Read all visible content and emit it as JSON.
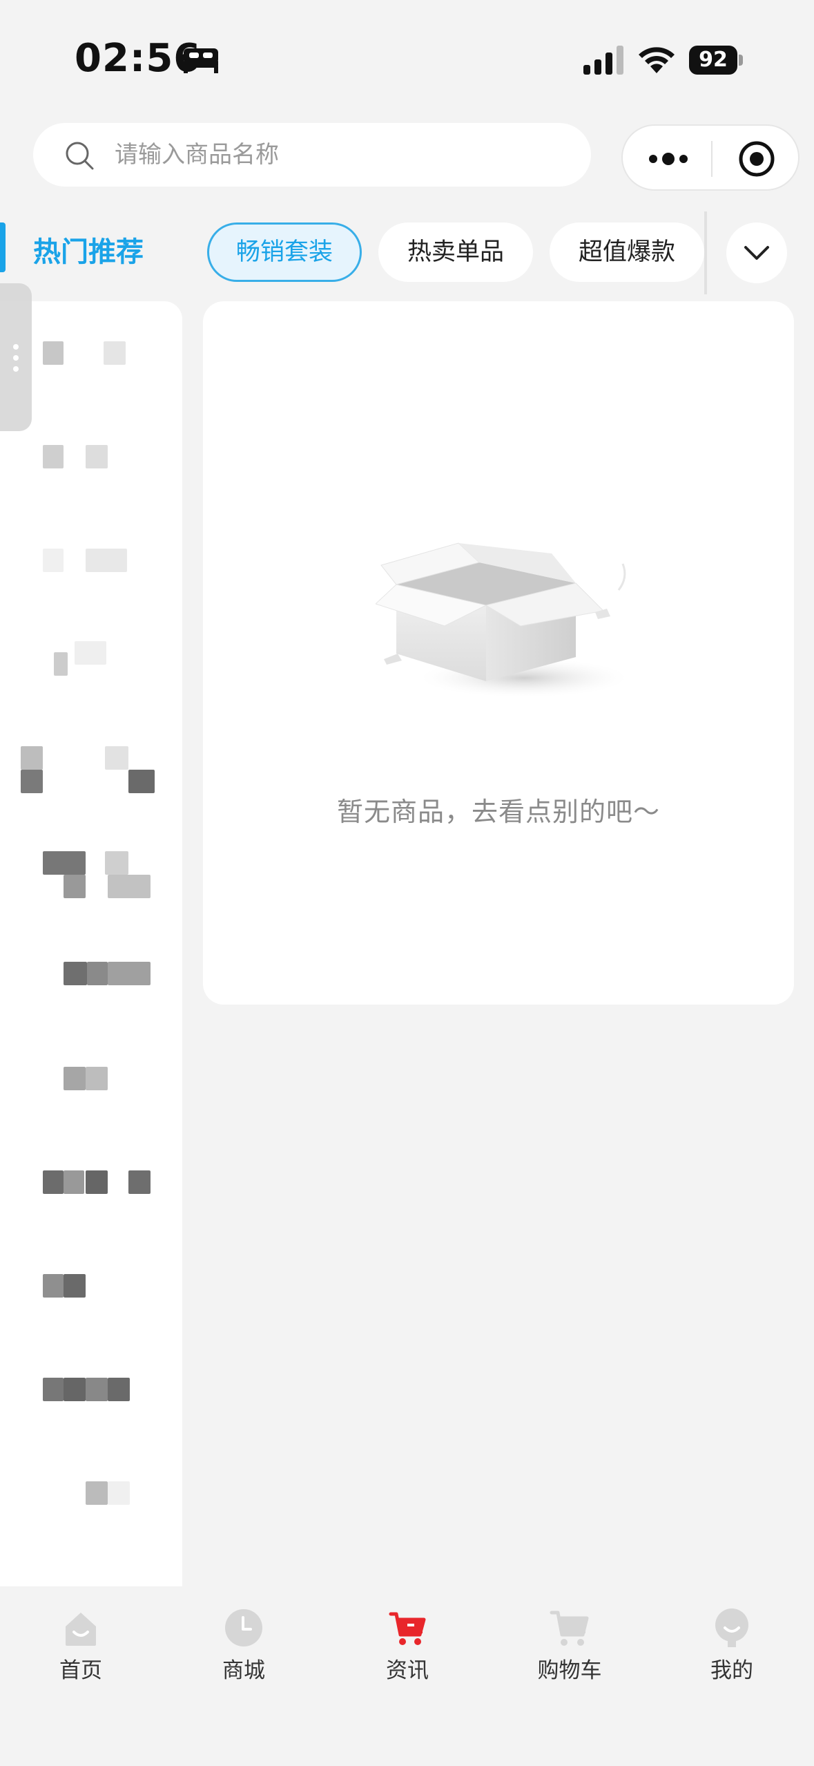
{
  "status_bar": {
    "time": "02:56",
    "battery": "92"
  },
  "search": {
    "placeholder": "请输入商品名称"
  },
  "category": {
    "title": "热门推荐"
  },
  "chips": [
    {
      "label": "畅销套装",
      "active": true
    },
    {
      "label": "热卖单品",
      "active": false
    },
    {
      "label": "超值爆款",
      "active": false
    }
  ],
  "empty_state": {
    "message": "暂无商品，去看点别的吧～"
  },
  "tab_bar": {
    "items": [
      {
        "label": "首页",
        "icon": "home-icon"
      },
      {
        "label": "商城",
        "icon": "clock-icon"
      },
      {
        "label": "资讯",
        "icon": "cart-icon",
        "active": true
      },
      {
        "label": "购物车",
        "icon": "shopping-cart-icon"
      },
      {
        "label": "我的",
        "icon": "profile-icon"
      }
    ]
  },
  "colors": {
    "accent": "#1aa3e8",
    "background": "#f3f3f3",
    "active_tab_icon": "#e8262b",
    "inactive_tab_icon": "#d6d6d6"
  }
}
